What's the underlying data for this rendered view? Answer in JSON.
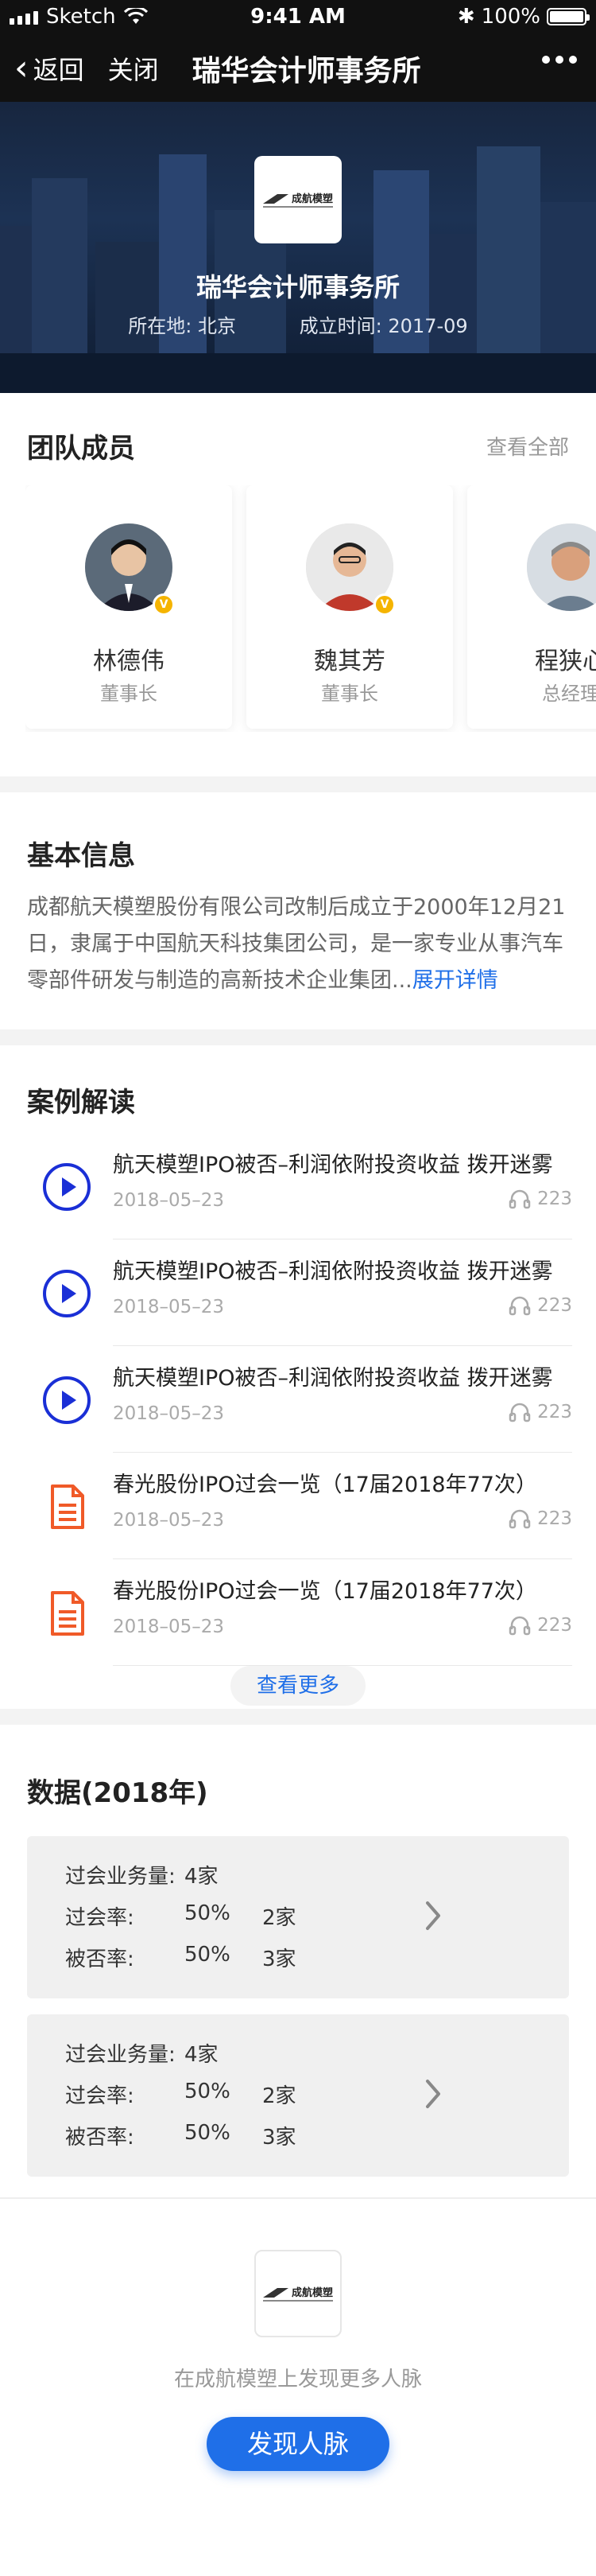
{
  "status": {
    "carrier": "Sketch",
    "time": "9:41 AM",
    "battery": "100%"
  },
  "nav": {
    "back": "返回",
    "close": "关闭",
    "title": "瑞华会计师事务所"
  },
  "hero": {
    "logo_text": "成航模塑",
    "logo_subtext": "CHENG HANG MOULDING PLASTIC",
    "name": "瑞华会计师事务所",
    "location_label": "所在地:",
    "location": "北京",
    "founded_label": "成立时间:",
    "founded": "2017-09"
  },
  "team": {
    "title": "团队成员",
    "view_all": "查看全部",
    "members": [
      {
        "name": "林德伟",
        "role": "董事长"
      },
      {
        "name": "魏其芳",
        "role": "董事长"
      },
      {
        "name": "程狭心",
        "role": "总经理"
      }
    ]
  },
  "info": {
    "title": "基本信息",
    "text": "成都航天模塑股份有限公司改制后成立于2000年12月21日，隶属于中国航天科技集团公司，是一家专业从事汽车零部件研发与制造的高新技术企业集团...",
    "expand": "展开详情"
  },
  "cases": {
    "title": "案例解读",
    "items": [
      {
        "type": "audio",
        "title": "航天模塑IPO被否–利润依附投资收益 拨开迷雾",
        "date": "2018–05–23",
        "count": "223"
      },
      {
        "type": "audio",
        "title": "航天模塑IPO被否–利润依附投资收益 拨开迷雾",
        "date": "2018–05–23",
        "count": "223"
      },
      {
        "type": "audio",
        "title": "航天模塑IPO被否–利润依附投资收益 拨开迷雾",
        "date": "2018–05–23",
        "count": "223"
      },
      {
        "type": "doc",
        "title": "春光股份IPO过会一览（17届2018年77次）",
        "date": "2018–05–23",
        "count": "223"
      },
      {
        "type": "doc",
        "title": "春光股份IPO过会一览（17届2018年77次）",
        "date": "2018–05–23",
        "count": "223"
      }
    ],
    "more": "查看更多"
  },
  "data_section": {
    "title": "数据(2018年)",
    "boxes": [
      {
        "r1_label": "过会业务量:",
        "r1_value": "4家",
        "r2_label": "过会率:",
        "r2_pct": "50%",
        "r2_value": "2家",
        "r3_label": "被否率:",
        "r3_pct": "50%",
        "r3_value": "3家"
      },
      {
        "r1_label": "过会业务量:",
        "r1_value": "4家",
        "r2_label": "过会率:",
        "r2_pct": "50%",
        "r2_value": "2家",
        "r3_label": "被否率:",
        "r3_pct": "50%",
        "r3_value": "3家"
      }
    ]
  },
  "footer": {
    "logo_text": "成航模塑",
    "text": "在成航模塑上发现更多人脉",
    "button": "发现人脉"
  },
  "colors": {
    "accent": "#1f6fe8",
    "play": "#1a2fd6",
    "doc": "#f05a28",
    "badge": "#f5b400"
  }
}
